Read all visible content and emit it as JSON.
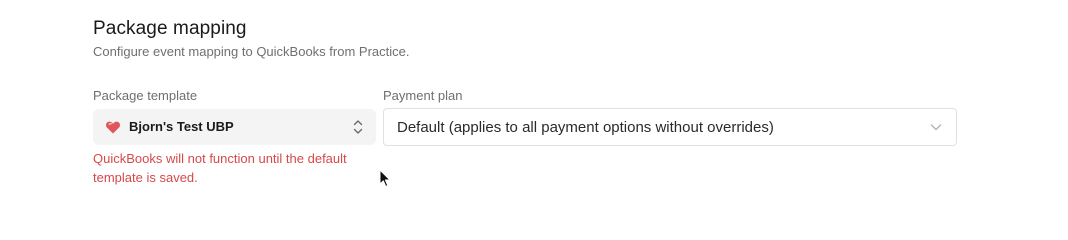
{
  "section": {
    "title": "Package mapping",
    "subtitle": "Configure event mapping to QuickBooks from Practice."
  },
  "package_template": {
    "label": "Package template",
    "icon": "heart-icon",
    "value": "Bjorn's Test UBP",
    "error": "QuickBooks will not function until the default template is saved."
  },
  "payment_plan": {
    "label": "Payment plan",
    "value": "Default (applies to all payment options without overrides)",
    "icon": "chevron-down-icon"
  },
  "colors": {
    "error": "#d6494a",
    "heart": "#e0565e",
    "select_bg": "#f4f4f4",
    "border": "#e1e1e1"
  }
}
